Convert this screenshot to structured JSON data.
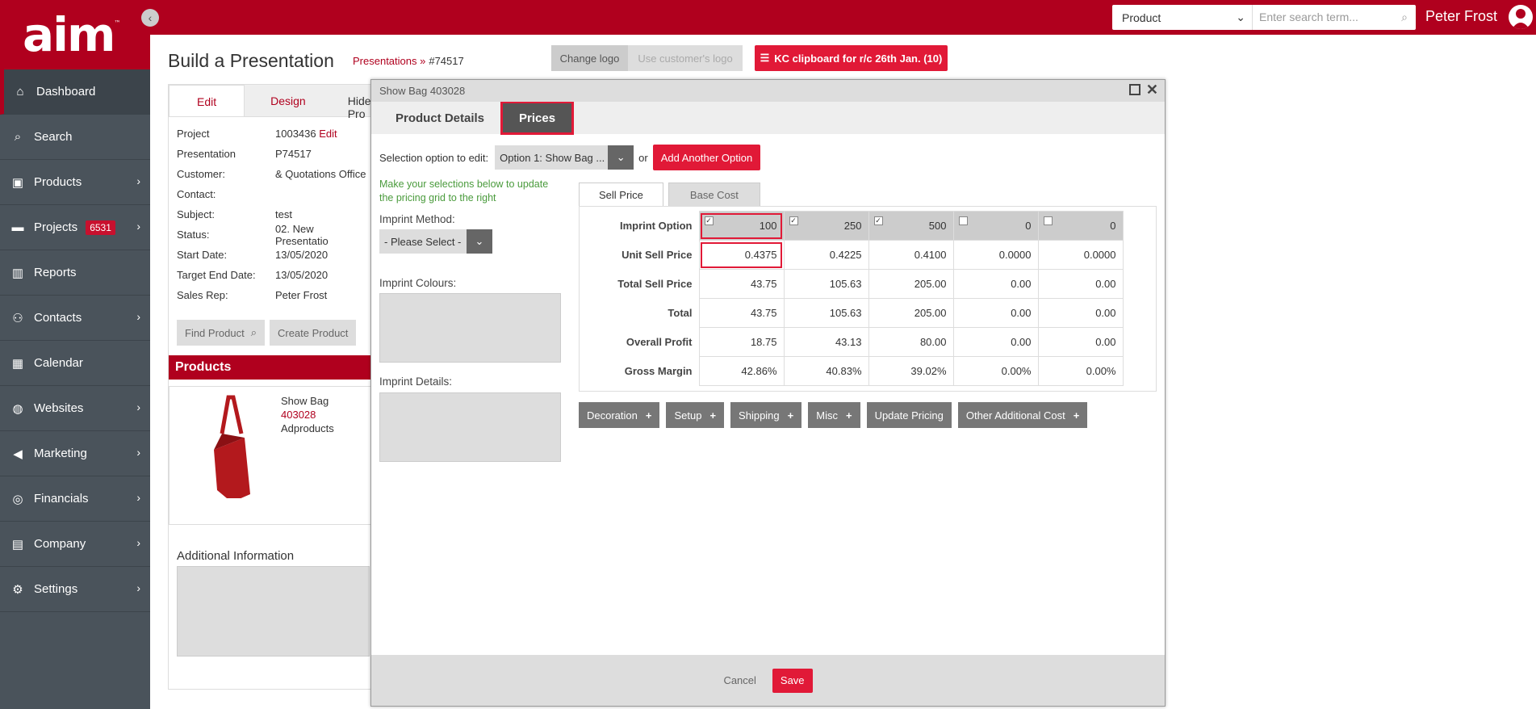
{
  "sidebar": {
    "logo": "aim",
    "logo_tm": "™",
    "items": [
      {
        "label": "Dashboard",
        "icon": "home-icon"
      },
      {
        "label": "Search",
        "icon": "search-icon"
      },
      {
        "label": "Products",
        "icon": "box-icon"
      },
      {
        "label": "Projects",
        "icon": "folder-icon",
        "badge": "6531"
      },
      {
        "label": "Reports",
        "icon": "chart-icon"
      },
      {
        "label": "Contacts",
        "icon": "people-icon"
      },
      {
        "label": "Calendar",
        "icon": "calendar-icon"
      },
      {
        "label": "Websites",
        "icon": "globe-icon"
      },
      {
        "label": "Marketing",
        "icon": "megaphone-icon"
      },
      {
        "label": "Financials",
        "icon": "coins-icon"
      },
      {
        "label": "Company",
        "icon": "building-icon"
      },
      {
        "label": "Settings",
        "icon": "gear-icon"
      }
    ]
  },
  "topbar": {
    "search_type": "Product",
    "search_placeholder": "Enter search term...",
    "user": "Peter Frost"
  },
  "page": {
    "title": "Build a Presentation",
    "crumb": "Presentations »",
    "crumb_id": "#74517",
    "change_logo": "Change logo",
    "use_logo": "Use customer's logo",
    "clipboard": "KC clipboard for r/c 26th Jan. (10)"
  },
  "left": {
    "tabs": [
      "Edit",
      "Design",
      "Hide Pro"
    ],
    "info": [
      [
        "Project",
        "1003436"
      ],
      [
        "Presentation",
        "P74517"
      ],
      [
        "Customer:",
        "& Quotations Office"
      ],
      [
        "Contact:",
        ""
      ],
      [
        "Subject:",
        "test"
      ],
      [
        "Status:",
        "02. New Presentatio"
      ],
      [
        "Start Date:",
        "13/05/2020"
      ],
      [
        "Target End Date:",
        "13/05/2020"
      ],
      [
        "Sales Rep:",
        "Peter Frost"
      ]
    ],
    "edit_link": "Edit",
    "find_product": "Find Product",
    "create_product": "Create Product",
    "products_heading": "Products",
    "product_name": "Show Bag",
    "product_code": "403028",
    "product_supplier": "Adproducts",
    "additional_info": "Additional Information"
  },
  "dialog": {
    "title": "Show Bag 403028",
    "tabs": [
      "Product Details",
      "Prices"
    ],
    "selection_label": "Selection option to edit:",
    "selection_value": "Option 1: Show Bag ...",
    "or": "or",
    "add_option": "Add Another Option",
    "hint": "Make your selections below to update the pricing grid to the right",
    "imprint_method": "Imprint Method:",
    "imprint_select": "- Please Select -",
    "imprint_colours": "Imprint Colours:",
    "imprint_details": "Imprint Details:",
    "price_tabs": [
      "Sell Price",
      "Base Cost"
    ],
    "grid": {
      "rows": [
        {
          "label": "Imprint Option",
          "cells": [
            "100",
            "250",
            "500",
            "0",
            "0"
          ],
          "checked": [
            true,
            true,
            true,
            false,
            false
          ]
        },
        {
          "label": "Unit Sell Price",
          "cells": [
            "0.4375",
            "0.4225",
            "0.4100",
            "0.0000",
            "0.0000"
          ]
        },
        {
          "label": "Total Sell Price",
          "cells": [
            "43.75",
            "105.63",
            "205.00",
            "0.00",
            "0.00"
          ]
        },
        {
          "label": "Total",
          "cells": [
            "43.75",
            "105.63",
            "205.00",
            "0.00",
            "0.00"
          ]
        },
        {
          "label": "Overall Profit",
          "cells": [
            "18.75",
            "43.13",
            "80.00",
            "0.00",
            "0.00"
          ]
        },
        {
          "label": "Gross Margin",
          "cells": [
            "42.86%",
            "40.83%",
            "39.02%",
            "0.00%",
            "0.00%"
          ]
        }
      ]
    },
    "actions": [
      "Decoration",
      "Setup",
      "Shipping",
      "Misc",
      "Update Pricing",
      "Other Additional Cost"
    ],
    "cancel": "Cancel",
    "save": "Save"
  }
}
